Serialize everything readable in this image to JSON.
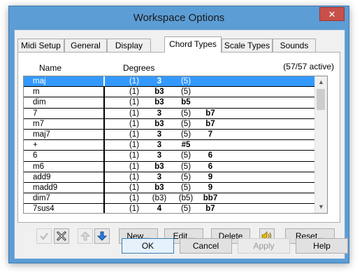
{
  "window": {
    "title": "Workspace Options",
    "close_glyph": "✕"
  },
  "tabs": [
    {
      "label": "Midi Setup"
    },
    {
      "label": "General"
    },
    {
      "label": "Display"
    },
    {
      "label": "Chord Types",
      "active": true
    },
    {
      "label": "Scale Types"
    },
    {
      "label": "Sounds"
    }
  ],
  "list": {
    "col_name": "Name",
    "col_degrees": "Degrees",
    "active_count": "(57/57 active)",
    "rows": [
      {
        "name": "maj",
        "degrees": [
          "(1)",
          "3",
          "(5)",
          ""
        ],
        "selected": true
      },
      {
        "name": "m",
        "degrees": [
          "(1)",
          "b3",
          "(5)",
          ""
        ]
      },
      {
        "name": "dim",
        "degrees": [
          "(1)",
          "b3",
          "b5",
          ""
        ]
      },
      {
        "name": "7",
        "degrees": [
          "(1)",
          "3",
          "(5)",
          "b7"
        ]
      },
      {
        "name": "m7",
        "degrees": [
          "(1)",
          "b3",
          "(5)",
          "b7"
        ]
      },
      {
        "name": "maj7",
        "degrees": [
          "(1)",
          "3",
          "(5)",
          "7"
        ]
      },
      {
        "name": "+",
        "degrees": [
          "(1)",
          "3",
          "#5",
          ""
        ]
      },
      {
        "name": "6",
        "degrees": [
          "(1)",
          "3",
          "(5)",
          "6"
        ]
      },
      {
        "name": "m6",
        "degrees": [
          "(1)",
          "b3",
          "(5)",
          "6"
        ]
      },
      {
        "name": "add9",
        "degrees": [
          "(1)",
          "3",
          "(5)",
          "9"
        ]
      },
      {
        "name": "madd9",
        "degrees": [
          "(1)",
          "b3",
          "(5)",
          "9"
        ]
      },
      {
        "name": "dim7",
        "degrees": [
          "(1)",
          "(b3)",
          "(b5)",
          "bb7"
        ]
      },
      {
        "name": "7sus4",
        "degrees": [
          "(1)",
          "4",
          "(5)",
          "b7"
        ]
      }
    ]
  },
  "toolbar": {
    "check_icon": "check-icon",
    "delete_icon": "x-icon",
    "move_up_icon": "arrow-up-icon",
    "move_down_icon": "arrow-down-icon",
    "new_label": "New...",
    "edit_label": "Edit...",
    "delete_label": "Delete",
    "sound_icon": "speaker-icon",
    "reset_label": "Reset..."
  },
  "footer": {
    "ok_label": "OK",
    "cancel_label": "Cancel",
    "apply_label": "Apply",
    "help_label": "Help"
  },
  "colors": {
    "frame": "#5c9dd6",
    "selection": "#3399ff",
    "close_button": "#c7504a"
  }
}
